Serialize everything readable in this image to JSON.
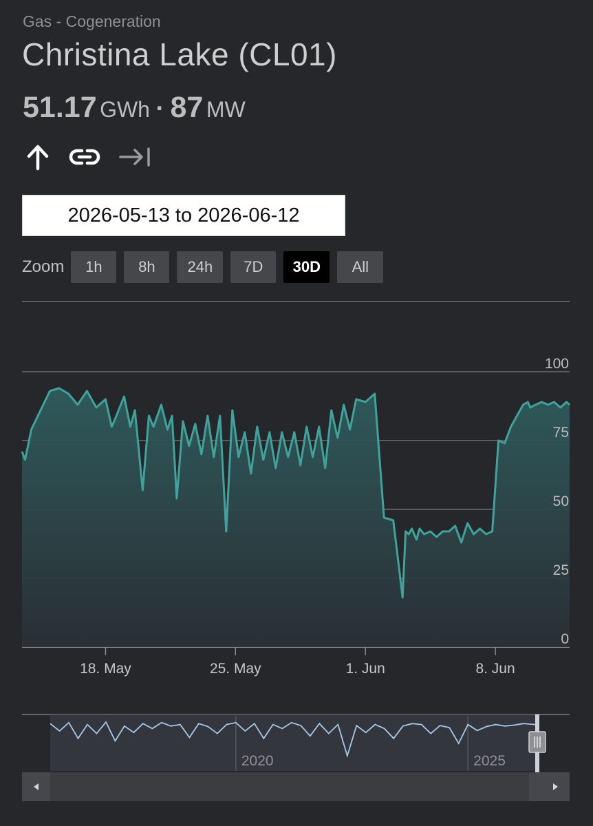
{
  "header": {
    "category": "Gas - Cogeneration",
    "title": "Christina Lake (CL01)",
    "energy_value": "51.17",
    "energy_unit": "GWh",
    "separator": "·",
    "power_value": "87",
    "power_unit": "MW"
  },
  "icons": [
    "arrow-up-icon",
    "link-icon",
    "collapse-right-icon"
  ],
  "date_range": "2026-05-13 to 2026-06-12",
  "zoom": {
    "label": "Zoom",
    "buttons": [
      "1h",
      "8h",
      "24h",
      "7D",
      "30D",
      "All"
    ],
    "active": "30D"
  },
  "colors": {
    "background": "#25272b",
    "line": "#3fa39c",
    "navigator_line": "#a9c7ea",
    "grid": "#6b6d71"
  },
  "chart_data": [
    {
      "type": "area",
      "title": "",
      "xlabel": "",
      "ylabel": "",
      "x_ticks": [
        "18. May",
        "25. May",
        "1. Jun",
        "8. Jun"
      ],
      "y_ticks": [
        "0",
        "25",
        "50",
        "75",
        "100"
      ],
      "ylim": [
        0,
        100
      ],
      "xlim": [
        "2026-05-13T12:00",
        "2026-06-12T00:00"
      ],
      "grid": true,
      "legend": "none",
      "x": [
        "2026-05-13T12:00",
        "2026-05-13T16:00",
        "2026-05-14T00:00",
        "2026-05-14T12:00",
        "2026-05-15T00:00",
        "2026-05-15T12:00",
        "2026-05-16T00:00",
        "2026-05-16T12:00",
        "2026-05-17T00:00",
        "2026-05-17T12:00",
        "2026-05-18T00:00",
        "2026-05-18T08:00",
        "2026-05-18T14:00",
        "2026-05-19T00:00",
        "2026-05-19T08:00",
        "2026-05-19T14:00",
        "2026-05-20T00:00",
        "2026-05-20T08:00",
        "2026-05-20T14:00",
        "2026-05-21T00:00",
        "2026-05-21T08:00",
        "2026-05-21T14:00",
        "2026-05-21T20:00",
        "2026-05-22T04:00",
        "2026-05-22T12:00",
        "2026-05-22T20:00",
        "2026-05-23T04:00",
        "2026-05-23T12:00",
        "2026-05-23T20:00",
        "2026-05-24T04:00",
        "2026-05-24T12:00",
        "2026-05-24T20:00",
        "2026-05-25T04:00",
        "2026-05-25T12:00",
        "2026-05-25T20:00",
        "2026-05-26T04:00",
        "2026-05-26T12:00",
        "2026-05-26T20:00",
        "2026-05-27T04:00",
        "2026-05-27T12:00",
        "2026-05-27T20:00",
        "2026-05-28T04:00",
        "2026-05-28T12:00",
        "2026-05-28T20:00",
        "2026-05-29T04:00",
        "2026-05-29T12:00",
        "2026-05-29T20:00",
        "2026-05-30T04:00",
        "2026-05-30T12:00",
        "2026-05-30T20:00",
        "2026-05-31T04:00",
        "2026-05-31T12:00",
        "2026-06-01T00:00",
        "2026-06-01T12:00",
        "2026-06-02T00:00",
        "2026-06-02T12:00",
        "2026-06-03T00:00",
        "2026-06-03T04:00",
        "2026-06-03T08:00",
        "2026-06-03T12:00",
        "2026-06-03T18:00",
        "2026-06-03T22:00",
        "2026-06-04T04:00",
        "2026-06-04T12:00",
        "2026-06-04T20:00",
        "2026-06-05T04:00",
        "2026-06-05T12:00",
        "2026-06-05T20:00",
        "2026-06-06T04:00",
        "2026-06-06T12:00",
        "2026-06-06T20:00",
        "2026-06-07T04:00",
        "2026-06-07T12:00",
        "2026-06-07T20:00",
        "2026-06-08T04:00",
        "2026-06-08T12:00",
        "2026-06-08T20:00",
        "2026-06-09T04:00",
        "2026-06-09T12:00",
        "2026-06-09T18:00",
        "2026-06-09T21:00",
        "2026-06-10T04:00",
        "2026-06-10T12:00",
        "2026-06-10T20:00",
        "2026-06-11T04:00",
        "2026-06-11T12:00",
        "2026-06-11T20:00",
        "2026-06-12T00:00"
      ],
      "values": [
        71,
        68,
        79,
        86,
        93,
        94,
        92,
        88,
        93,
        87,
        90,
        80,
        84,
        91,
        80,
        86,
        57,
        84,
        80,
        88,
        79,
        84,
        54,
        82,
        73,
        81,
        70,
        84,
        69,
        84,
        42,
        86,
        69,
        78,
        63,
        80,
        68,
        78,
        65,
        78,
        69,
        78,
        66,
        80,
        69,
        80,
        65,
        86,
        76,
        88,
        79,
        90,
        89,
        92,
        47,
        46,
        18,
        42,
        41,
        43,
        39,
        43,
        41,
        42,
        40,
        42,
        42,
        44,
        38,
        45,
        41,
        43,
        41,
        42,
        75,
        74,
        80,
        84,
        88,
        89,
        87,
        88,
        89,
        88,
        89,
        87,
        89,
        88
      ],
      "highlight_extra_note": ""
    },
    {
      "type": "line",
      "title": "",
      "x_ticks": [
        "2020",
        "2025"
      ],
      "grid": true,
      "legend": "none",
      "x": [
        2016.0,
        2016.2,
        2016.4,
        2016.6,
        2016.8,
        2017.0,
        2017.2,
        2017.4,
        2017.6,
        2017.8,
        2018.0,
        2018.2,
        2018.4,
        2018.6,
        2018.8,
        2019.0,
        2019.2,
        2019.4,
        2019.6,
        2019.8,
        2020.0,
        2020.2,
        2020.4,
        2020.6,
        2020.8,
        2021.0,
        2021.2,
        2021.4,
        2021.6,
        2021.8,
        2022.0,
        2022.2,
        2022.4,
        2022.6,
        2022.8,
        2023.0,
        2023.2,
        2023.4,
        2023.6,
        2023.8,
        2024.0,
        2024.2,
        2024.4,
        2024.6,
        2024.8,
        2025.0,
        2025.2,
        2025.4,
        2025.6,
        2025.8,
        2026.0,
        2026.2,
        2026.45
      ],
      "values": [
        90,
        75,
        92,
        60,
        88,
        70,
        93,
        55,
        85,
        72,
        90,
        80,
        92,
        85,
        88,
        62,
        90,
        84,
        70,
        88,
        92,
        75,
        90,
        60,
        88,
        80,
        92,
        86,
        65,
        90,
        70,
        88,
        25,
        86,
        72,
        88,
        80,
        60,
        85,
        90,
        88,
        70,
        86,
        82,
        50,
        88,
        76,
        84,
        88,
        85,
        87,
        90,
        88
      ]
    }
  ]
}
